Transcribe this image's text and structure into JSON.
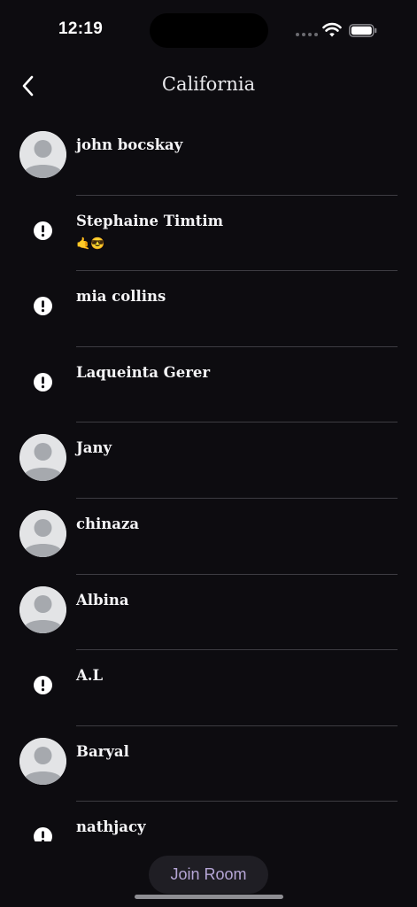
{
  "status_bar": {
    "time": "12:19"
  },
  "header": {
    "title": "California"
  },
  "members": [
    {
      "name": "john bocskay",
      "avatar": "placeholder",
      "status": ""
    },
    {
      "name": "Stephaine Timtim",
      "avatar": "alert",
      "status": "🤙😎"
    },
    {
      "name": "mia collins",
      "avatar": "alert",
      "status": ""
    },
    {
      "name": "Laqueinta Gerer",
      "avatar": "alert",
      "status": ""
    },
    {
      "name": "Jany",
      "avatar": "placeholder",
      "status": ""
    },
    {
      "name": "chinaza",
      "avatar": "placeholder",
      "status": ""
    },
    {
      "name": "Albina",
      "avatar": "placeholder",
      "status": ""
    },
    {
      "name": "A.L",
      "avatar": "alert",
      "status": ""
    },
    {
      "name": "Baryal",
      "avatar": "placeholder",
      "status": ""
    },
    {
      "name": "nathjacy",
      "avatar": "alert",
      "status": ""
    }
  ],
  "footer": {
    "join_label": "Join Room"
  },
  "colors": {
    "background": "#0d0c10",
    "accent": "#b6a6d6",
    "divider": "#3d3c42"
  }
}
